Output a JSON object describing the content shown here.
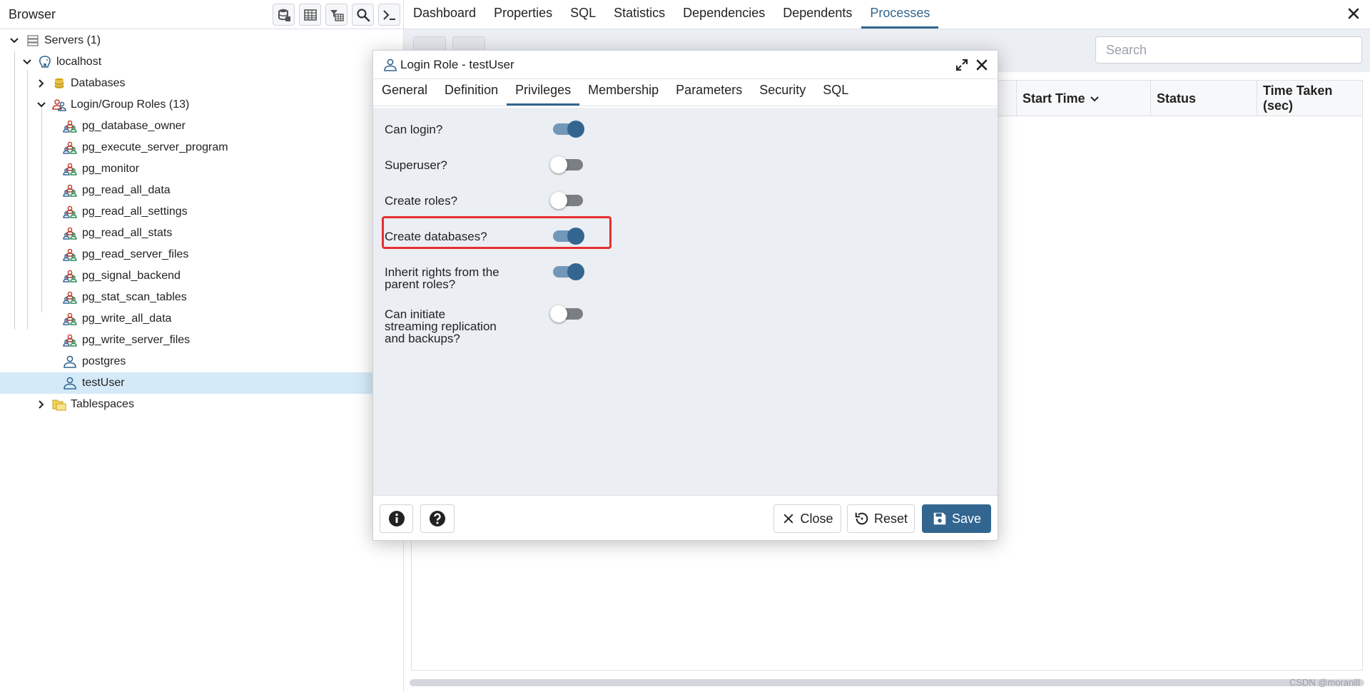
{
  "browser": {
    "title": "Browser",
    "toolbar": [
      "database-object-icon",
      "table-view-icon",
      "filter-table-icon",
      "search-icon",
      "terminal-icon"
    ],
    "tree": {
      "servers": "Servers (1)",
      "localhost": "localhost",
      "databases": "Databases",
      "login_roles": "Login/Group Roles (13)",
      "roles": [
        "pg_database_owner",
        "pg_execute_server_program",
        "pg_monitor",
        "pg_read_all_data",
        "pg_read_all_settings",
        "pg_read_all_stats",
        "pg_read_server_files",
        "pg_signal_backend",
        "pg_stat_scan_tables",
        "pg_write_all_data",
        "pg_write_server_files",
        "postgres",
        "testUser"
      ],
      "tablespaces": "Tablespaces"
    }
  },
  "main": {
    "tabs": [
      "Dashboard",
      "Properties",
      "SQL",
      "Statistics",
      "Dependencies",
      "Dependents",
      "Processes"
    ],
    "active_tab": "Processes",
    "search_placeholder": "Search",
    "columns": [
      "Start Time",
      "Status",
      "Time Taken (sec)"
    ]
  },
  "dialog": {
    "title": "Login Role - testUser",
    "tabs": [
      "General",
      "Definition",
      "Privileges",
      "Membership",
      "Parameters",
      "Security",
      "SQL"
    ],
    "active_tab": "Privileges",
    "privileges": [
      {
        "label": "Can login?",
        "on": true
      },
      {
        "label": "Superuser?",
        "on": false
      },
      {
        "label": "Create roles?",
        "on": false
      },
      {
        "label": "Create databases?",
        "on": true
      },
      {
        "label_lines": [
          "Inherit rights from the",
          "parent roles?"
        ],
        "on": true
      },
      {
        "label_lines": [
          "Can initiate",
          "streaming replication",
          "and backups?"
        ],
        "on": false
      }
    ],
    "footer": {
      "close": "Close",
      "reset": "Reset",
      "save": "Save"
    }
  },
  "watermark": "CSDN @moranlll",
  "colors": {
    "accent": "#326690",
    "selected_row": "#d5eaf8",
    "highlight": "#e53030"
  }
}
